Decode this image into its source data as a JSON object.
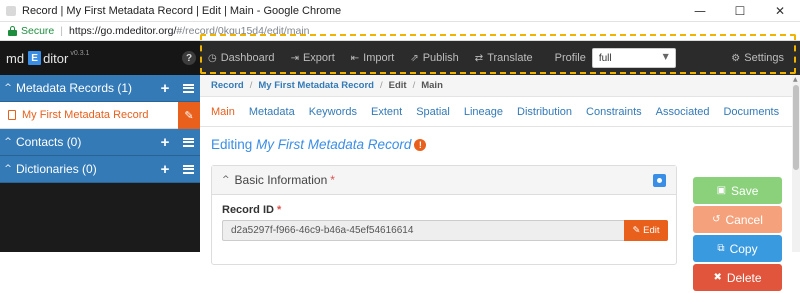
{
  "window": {
    "title": "Record | My First Metadata Record | Edit | Main - Google Chrome",
    "controls": {
      "minimize": "—",
      "maximize": "☐",
      "close": "✕"
    }
  },
  "address": {
    "secure_label": "Secure",
    "url_host": "https://go.mdeditor.org/",
    "url_path": "#/record/0kgu15d4/edit/main"
  },
  "brand": {
    "md": "md",
    "e": "E",
    "name": "ditor",
    "version": "v0.3.1",
    "help": "?"
  },
  "sidebar": {
    "sections": [
      {
        "label": "Metadata Records (1)",
        "add": "+",
        "chevron": "^"
      },
      {
        "label": "Contacts (0)",
        "add": "+",
        "chevron": "^"
      },
      {
        "label": "Dictionaries (0)",
        "add": "+",
        "chevron": "^"
      }
    ],
    "active_record": {
      "label": "My First Metadata Record",
      "edit_icon": "✎"
    }
  },
  "topnav": {
    "items": [
      {
        "icon": "dashboard-icon",
        "glyph": "◷",
        "label": "Dashboard"
      },
      {
        "icon": "export-icon",
        "glyph": "⇥",
        "label": "Export"
      },
      {
        "icon": "import-icon",
        "glyph": "⇤",
        "label": "Import"
      },
      {
        "icon": "publish-icon",
        "glyph": "⇗",
        "label": "Publish"
      },
      {
        "icon": "translate-icon",
        "glyph": "⇄",
        "label": "Translate"
      }
    ],
    "profile_label": "Profile",
    "profile_value": "full",
    "settings_label": "Settings",
    "settings_glyph": "⚙"
  },
  "breadcrumb": [
    {
      "label": "Record"
    },
    {
      "label": "My First Metadata Record"
    },
    {
      "label": "Edit"
    },
    {
      "label": "Main"
    }
  ],
  "tabs": [
    {
      "label": "Main",
      "active": true
    },
    {
      "label": "Metadata"
    },
    {
      "label": "Keywords"
    },
    {
      "label": "Extent"
    },
    {
      "label": "Spatial"
    },
    {
      "label": "Lineage"
    },
    {
      "label": "Distribution"
    },
    {
      "label": "Constraints"
    },
    {
      "label": "Associated"
    },
    {
      "label": "Documents"
    }
  ],
  "editor": {
    "heading_prefix": "Editing ",
    "heading_record": "My First Metadata Record",
    "info_glyph": "!",
    "panel_title": "Basic Information",
    "required_mark": "*",
    "record_id_label": "Record ID",
    "record_id_value": "d2a5297f-f966-46c9-b46a-45ef54616614",
    "edit_button_label": "Edit",
    "edit_button_glyph": "✎"
  },
  "actions": {
    "save": {
      "label": "Save",
      "glyph": "▣"
    },
    "cancel": {
      "label": "Cancel",
      "glyph": "↺"
    },
    "copy": {
      "label": "Copy",
      "glyph": "⧉"
    },
    "delete": {
      "label": "Delete",
      "glyph": "✖"
    }
  },
  "colors": {
    "accent_blue": "#337ab7",
    "accent_orange": "#e8601c",
    "highlight_dashed": "#f0b400",
    "save_green": "#8bd17c",
    "cancel_salmon": "#f5a27c",
    "copy_blue": "#3a9ae0",
    "delete_red": "#e0553b"
  }
}
